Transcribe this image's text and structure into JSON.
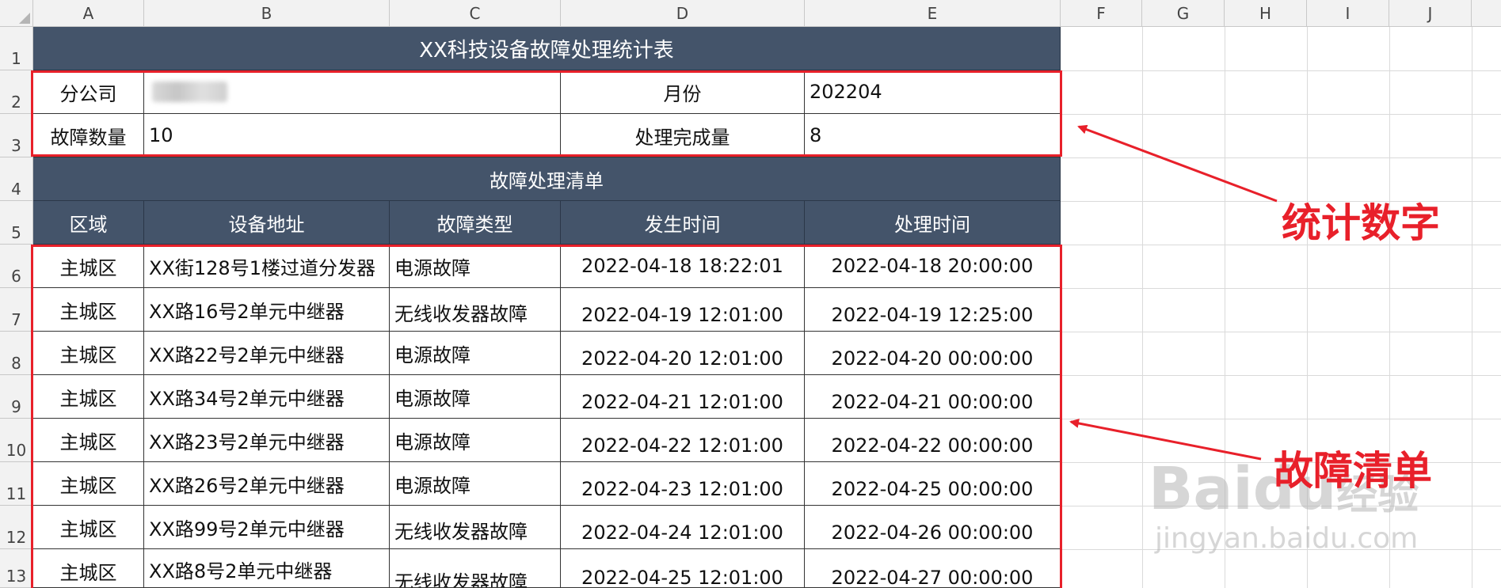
{
  "columns": [
    "A",
    "B",
    "C",
    "D",
    "E",
    "F",
    "G",
    "H",
    "I",
    "J"
  ],
  "rows": [
    "1",
    "2",
    "3",
    "4",
    "5",
    "6",
    "7",
    "8",
    "9",
    "10",
    "11",
    "12",
    "13"
  ],
  "table": {
    "title": "XX科技设备故障处理统计表",
    "branch_label": "分公司",
    "month_label": "月份",
    "month_value": "202204",
    "fault_count_label": "故障数量",
    "fault_count_value": "10",
    "completed_label": "处理完成量",
    "completed_value": "8",
    "list_title": "故障处理清单",
    "headers": [
      "区域",
      "设备地址",
      "故障类型",
      "发生时间",
      "处理时间"
    ],
    "records": [
      {
        "area": "主城区",
        "address": "XX街128号1楼过道分发器",
        "type": "电源故障",
        "occurred": "2022-04-18 18:22:01",
        "handled": "2022-04-18 20:00:00"
      },
      {
        "area": "主城区",
        "address": "XX路16号2单元中继器",
        "type": "无线收发器故障",
        "occurred": "2022-04-19 12:01:00",
        "handled": "2022-04-19 12:25:00"
      },
      {
        "area": "主城区",
        "address": "XX路22号2单元中继器",
        "type": "电源故障",
        "occurred": "2022-04-20 12:01:00",
        "handled": "2022-04-20 00:00:00"
      },
      {
        "area": "主城区",
        "address": "XX路34号2单元中继器",
        "type": "电源故障",
        "occurred": "2022-04-21 12:01:00",
        "handled": "2022-04-21 00:00:00"
      },
      {
        "area": "主城区",
        "address": "XX路23号2单元中继器",
        "type": "电源故障",
        "occurred": "2022-04-22 12:01:00",
        "handled": "2022-04-22 00:00:00"
      },
      {
        "area": "主城区",
        "address": "XX路26号2单元中继器",
        "type": "电源故障",
        "occurred": "2022-04-23 12:01:00",
        "handled": "2022-04-25 00:00:00"
      },
      {
        "area": "主城区",
        "address": "XX路99号2单元中继器",
        "type": "无线收发器故障",
        "occurred": "2022-04-24 12:01:00",
        "handled": "2022-04-26 00:00:00"
      },
      {
        "area": "主城区",
        "address": "XX路8号2单元中继器",
        "type": "无线收发器故障",
        "occurred": "2022-04-25 12:01:00",
        "handled": "2022-04-27 00:00:00"
      }
    ]
  },
  "annotations": {
    "stats_label": "统计数字",
    "list_label": "故障清单",
    "color": "#e8202a"
  },
  "watermark": {
    "brand": "Baidu",
    "brand_cn": "经验",
    "site": "jingyan.baidu.com"
  },
  "colors": {
    "header_fill": "#44546a",
    "highlight": "#e8202a"
  }
}
